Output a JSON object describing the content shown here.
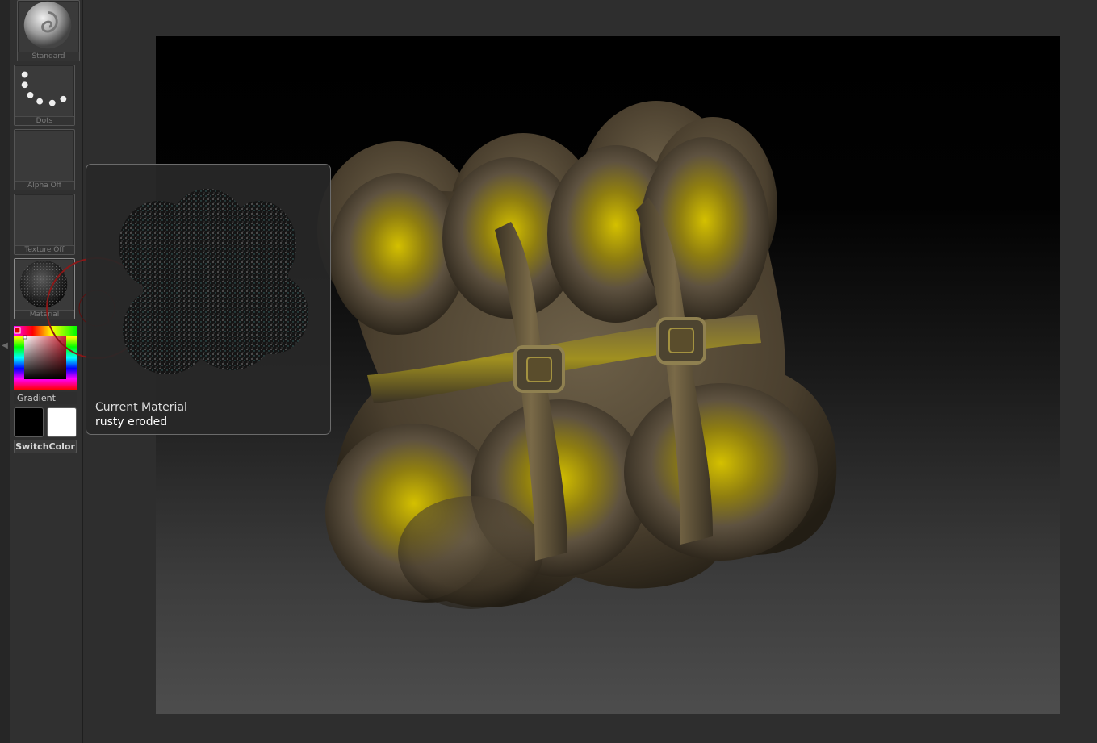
{
  "shelf": {
    "brush": {
      "label": "Standard"
    },
    "stroke": {
      "label": "Dots"
    },
    "alpha": {
      "label": "Alpha Off"
    },
    "texture": {
      "label": "Texture Off"
    },
    "material": {
      "label": "Material"
    },
    "gradient": {
      "label": "Gradient"
    },
    "switch_color": {
      "label": "SwitchColor"
    },
    "primary_color": "#000000",
    "secondary_color": "#ffffff"
  },
  "tooltip": {
    "title": "Current Material",
    "value": "rusty eroded"
  },
  "colors": {
    "accent_gold": "#c8b400",
    "surface_brown": "#5e5240"
  }
}
